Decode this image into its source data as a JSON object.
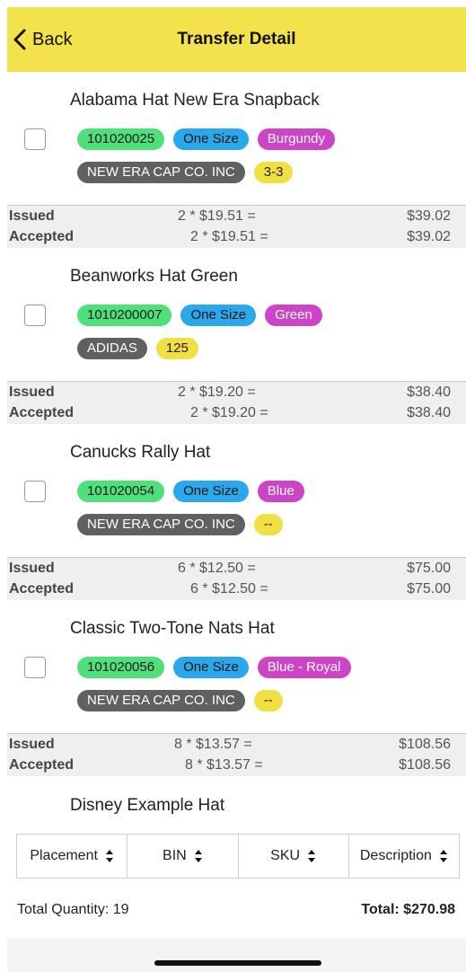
{
  "header": {
    "back_label": "Back",
    "title": "Transfer Detail"
  },
  "items": [
    {
      "name": "Alabama Hat New Era Snapback",
      "sku": "101020025",
      "size": "One Size",
      "color": "Burgundy",
      "brand": "NEW ERA CAP CO. INC",
      "qty": "3-3",
      "issued_label": "Issued",
      "issued_calc": "2 * $19.51 =",
      "issued_amount": "$39.02",
      "accepted_label": "Accepted",
      "accepted_calc": "2 * $19.51 =",
      "accepted_amount": "$39.02"
    },
    {
      "name": "Beanworks Hat Green",
      "sku": "1010200007",
      "size": "One Size",
      "color": "Green",
      "brand": "ADIDAS",
      "qty": "125",
      "issued_label": "Issued",
      "issued_calc": "2 * $19.20 =",
      "issued_amount": "$38.40",
      "accepted_label": "Accepted",
      "accepted_calc": "2 * $19.20 =",
      "accepted_amount": "$38.40"
    },
    {
      "name": "Canucks Rally Hat",
      "sku": "101020054",
      "size": "One Size",
      "color": "Blue",
      "brand": "NEW ERA CAP CO. INC",
      "qty": "--",
      "issued_label": "Issued",
      "issued_calc": "6 * $12.50 =",
      "issued_amount": "$75.00",
      "accepted_label": "Accepted",
      "accepted_calc": "6 * $12.50 =",
      "accepted_amount": "$75.00"
    },
    {
      "name": "Classic Two-Tone Nats Hat",
      "sku": "101020056",
      "size": "One Size",
      "color": "Blue - Royal",
      "brand": "NEW ERA CAP CO. INC",
      "qty": "--",
      "issued_label": "Issued",
      "issued_calc": "8 * $13.57 =",
      "issued_amount": "$108.56",
      "accepted_label": "Accepted",
      "accepted_calc": "8 * $13.57 =",
      "accepted_amount": "$108.56"
    }
  ],
  "partial_item": {
    "name": "Disney Example Hat"
  },
  "table_columns": [
    "Placement",
    "BIN",
    "SKU",
    "Description"
  ],
  "totals": {
    "quantity": "Total Quantity: 19",
    "total": "Total: $270.98"
  },
  "colors": {
    "header": "#f3e24c",
    "sku_tag": "#4fe07c",
    "size_tag": "#29a9ec",
    "color_tag": "#cd45c6",
    "brand_tag": "#606060",
    "qty_tag": "#f2df43"
  },
  "icons": {
    "back": "chevron-left-icon",
    "sort": "sort-updown-icon"
  }
}
